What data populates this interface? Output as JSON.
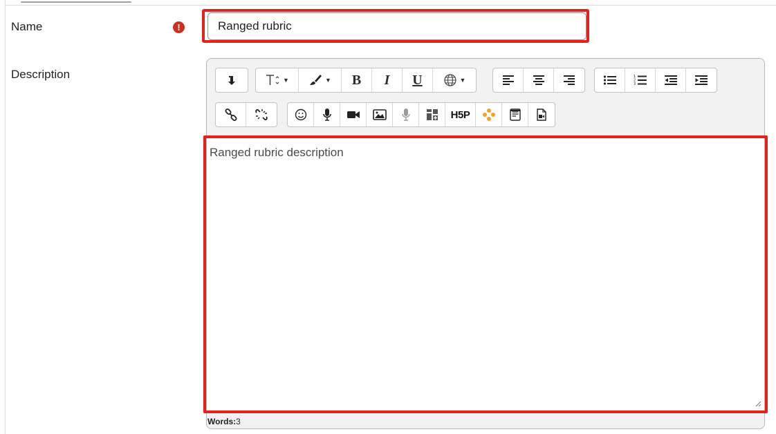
{
  "form": {
    "name": {
      "label": "Name",
      "required_icon": "exclamation-circle-icon",
      "value": "Ranged rubric"
    },
    "description": {
      "label": "Description",
      "content": "Ranged rubric description",
      "word_count_label": "Words:",
      "word_count": "3"
    }
  },
  "toolbar": {
    "row1": [
      {
        "icon": "toolbar-toggle-icon"
      },
      {
        "icon": "font-size-icon"
      },
      {
        "icon": "paint-brush-icon"
      },
      {
        "icon": "bold-icon",
        "glyph": "B"
      },
      {
        "icon": "italic-icon",
        "glyph": "I"
      },
      {
        "icon": "underline-icon",
        "glyph": "U"
      },
      {
        "icon": "language-globe-icon"
      },
      {
        "icon": "align-left-icon"
      },
      {
        "icon": "align-center-icon"
      },
      {
        "icon": "align-right-icon"
      },
      {
        "icon": "unordered-list-icon"
      },
      {
        "icon": "ordered-list-icon"
      },
      {
        "icon": "outdent-icon"
      },
      {
        "icon": "indent-icon"
      }
    ],
    "row2": [
      {
        "icon": "link-icon"
      },
      {
        "icon": "unlink-icon"
      },
      {
        "icon": "emoji-icon"
      },
      {
        "icon": "record-audio-icon"
      },
      {
        "icon": "record-video-icon"
      },
      {
        "icon": "insert-image-icon"
      },
      {
        "icon": "microphone-disabled-icon"
      },
      {
        "icon": "manage-files-icon"
      },
      {
        "icon": "h5p-icon",
        "glyph": "H5P"
      },
      {
        "icon": "dots-plugin-icon"
      },
      {
        "icon": "template-icon"
      },
      {
        "icon": "media-file-icon"
      }
    ]
  },
  "colors": {
    "highlight": "#e0241d",
    "required": "#ca3120",
    "accent_orange": "#f0a02d"
  }
}
